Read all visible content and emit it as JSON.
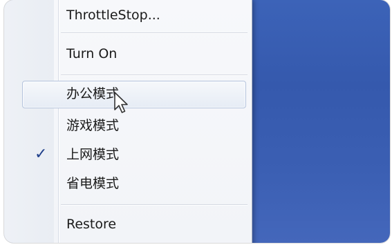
{
  "menu": {
    "items": [
      {
        "label": "ThrottleStop..."
      },
      {
        "label": "Turn On"
      },
      {
        "label": "办公模式"
      },
      {
        "label": "游戏模式"
      },
      {
        "label": "上网模式",
        "checked": true
      },
      {
        "label": "省电模式"
      },
      {
        "label": "Restore"
      }
    ],
    "check_glyph": "✓",
    "hovered_item": "办公模式"
  },
  "colors": {
    "desktop": "#3c63b8",
    "menu_background": "#f4f6f9",
    "check": "#1f3f8a"
  },
  "icons": {
    "cursor": "arrow-cursor-icon",
    "check": "checkmark-icon"
  }
}
